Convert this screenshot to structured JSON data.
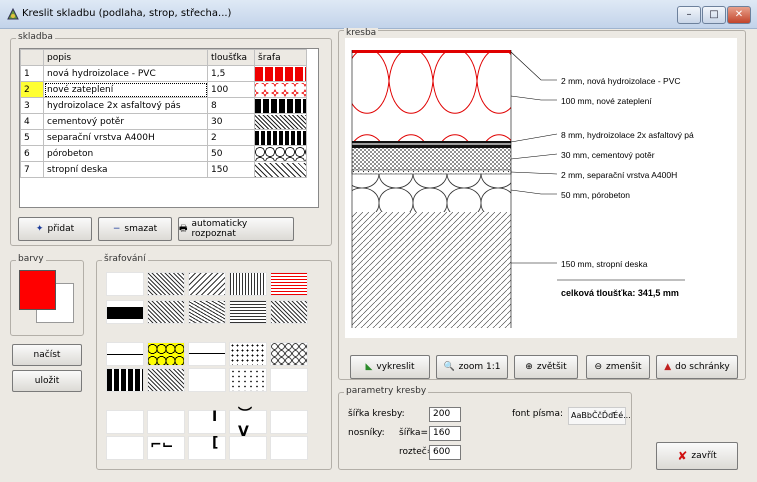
{
  "window": {
    "title": "Kreslit skladbu (podlaha, strop, střecha...)",
    "controls": {
      "minimize": "–",
      "maximize": "□",
      "close": "✕"
    }
  },
  "skladba": {
    "group_label": "skladba",
    "columns": {
      "num": "",
      "popis": "popis",
      "tloustka": "tloušťka",
      "srafa": "šrafa"
    },
    "rows": [
      {
        "num": "1",
        "popis": "nová hydroizolace - PVC",
        "tloustka": "1,5"
      },
      {
        "num": "2",
        "popis": "nové zateplení",
        "tloustka": "100"
      },
      {
        "num": "3",
        "popis": "hydroizolace 2x asfaltový pás",
        "tloustka": "8"
      },
      {
        "num": "4",
        "popis": "cementový potěr",
        "tloustka": "30"
      },
      {
        "num": "5",
        "popis": "separační vrstva A400H",
        "tloustka": "2"
      },
      {
        "num": "6",
        "popis": "pórobeton",
        "tloustka": "50"
      },
      {
        "num": "7",
        "popis": "stropní deska",
        "tloustka": "150"
      }
    ],
    "buttons": {
      "pridat": "přidat",
      "smazat": "smazat",
      "auto": "automaticky rozpoznat"
    }
  },
  "barvy": {
    "group_label": "barvy",
    "colors": {
      "fore": "#ff0000",
      "back": "#ffffff"
    }
  },
  "side_buttons": {
    "nacist": "načíst",
    "ulozit": "uložit"
  },
  "srafovani": {
    "group_label": "šrafování"
  },
  "kresba": {
    "group_label": "kresba",
    "annotations": [
      "2 mm, nová hydroizolace - PVC",
      "100 mm, nové zateplení",
      "8 mm, hydroizolace 2x asfaltový pá",
      "30 mm, cementový potěr",
      "2 mm, separační vrstva A400H",
      "50 mm, pórobeton",
      "150 mm, stropní deska"
    ],
    "total": "celková tloušťka: 341,5 mm",
    "buttons": {
      "vykreslit": "vykreslit",
      "zoom": "zoom 1:1",
      "zvetsit": "zvětšit",
      "zmensit": "zmenšit",
      "schranky": "do schránky"
    }
  },
  "parametry": {
    "group_label": "parametry kresby",
    "sirka_kresby_label": "šířka kresby:",
    "sirka_kresby": "200",
    "nosniky_label": "nosníky:",
    "sirka_label": "šířka=",
    "sirka": "160",
    "rozteč_label": "rozteč=",
    "roztec": "600",
    "font_label": "font písma:",
    "font_sample": "AaBbČčĎďÉé..."
  },
  "zavrit_label": "zavřít"
}
